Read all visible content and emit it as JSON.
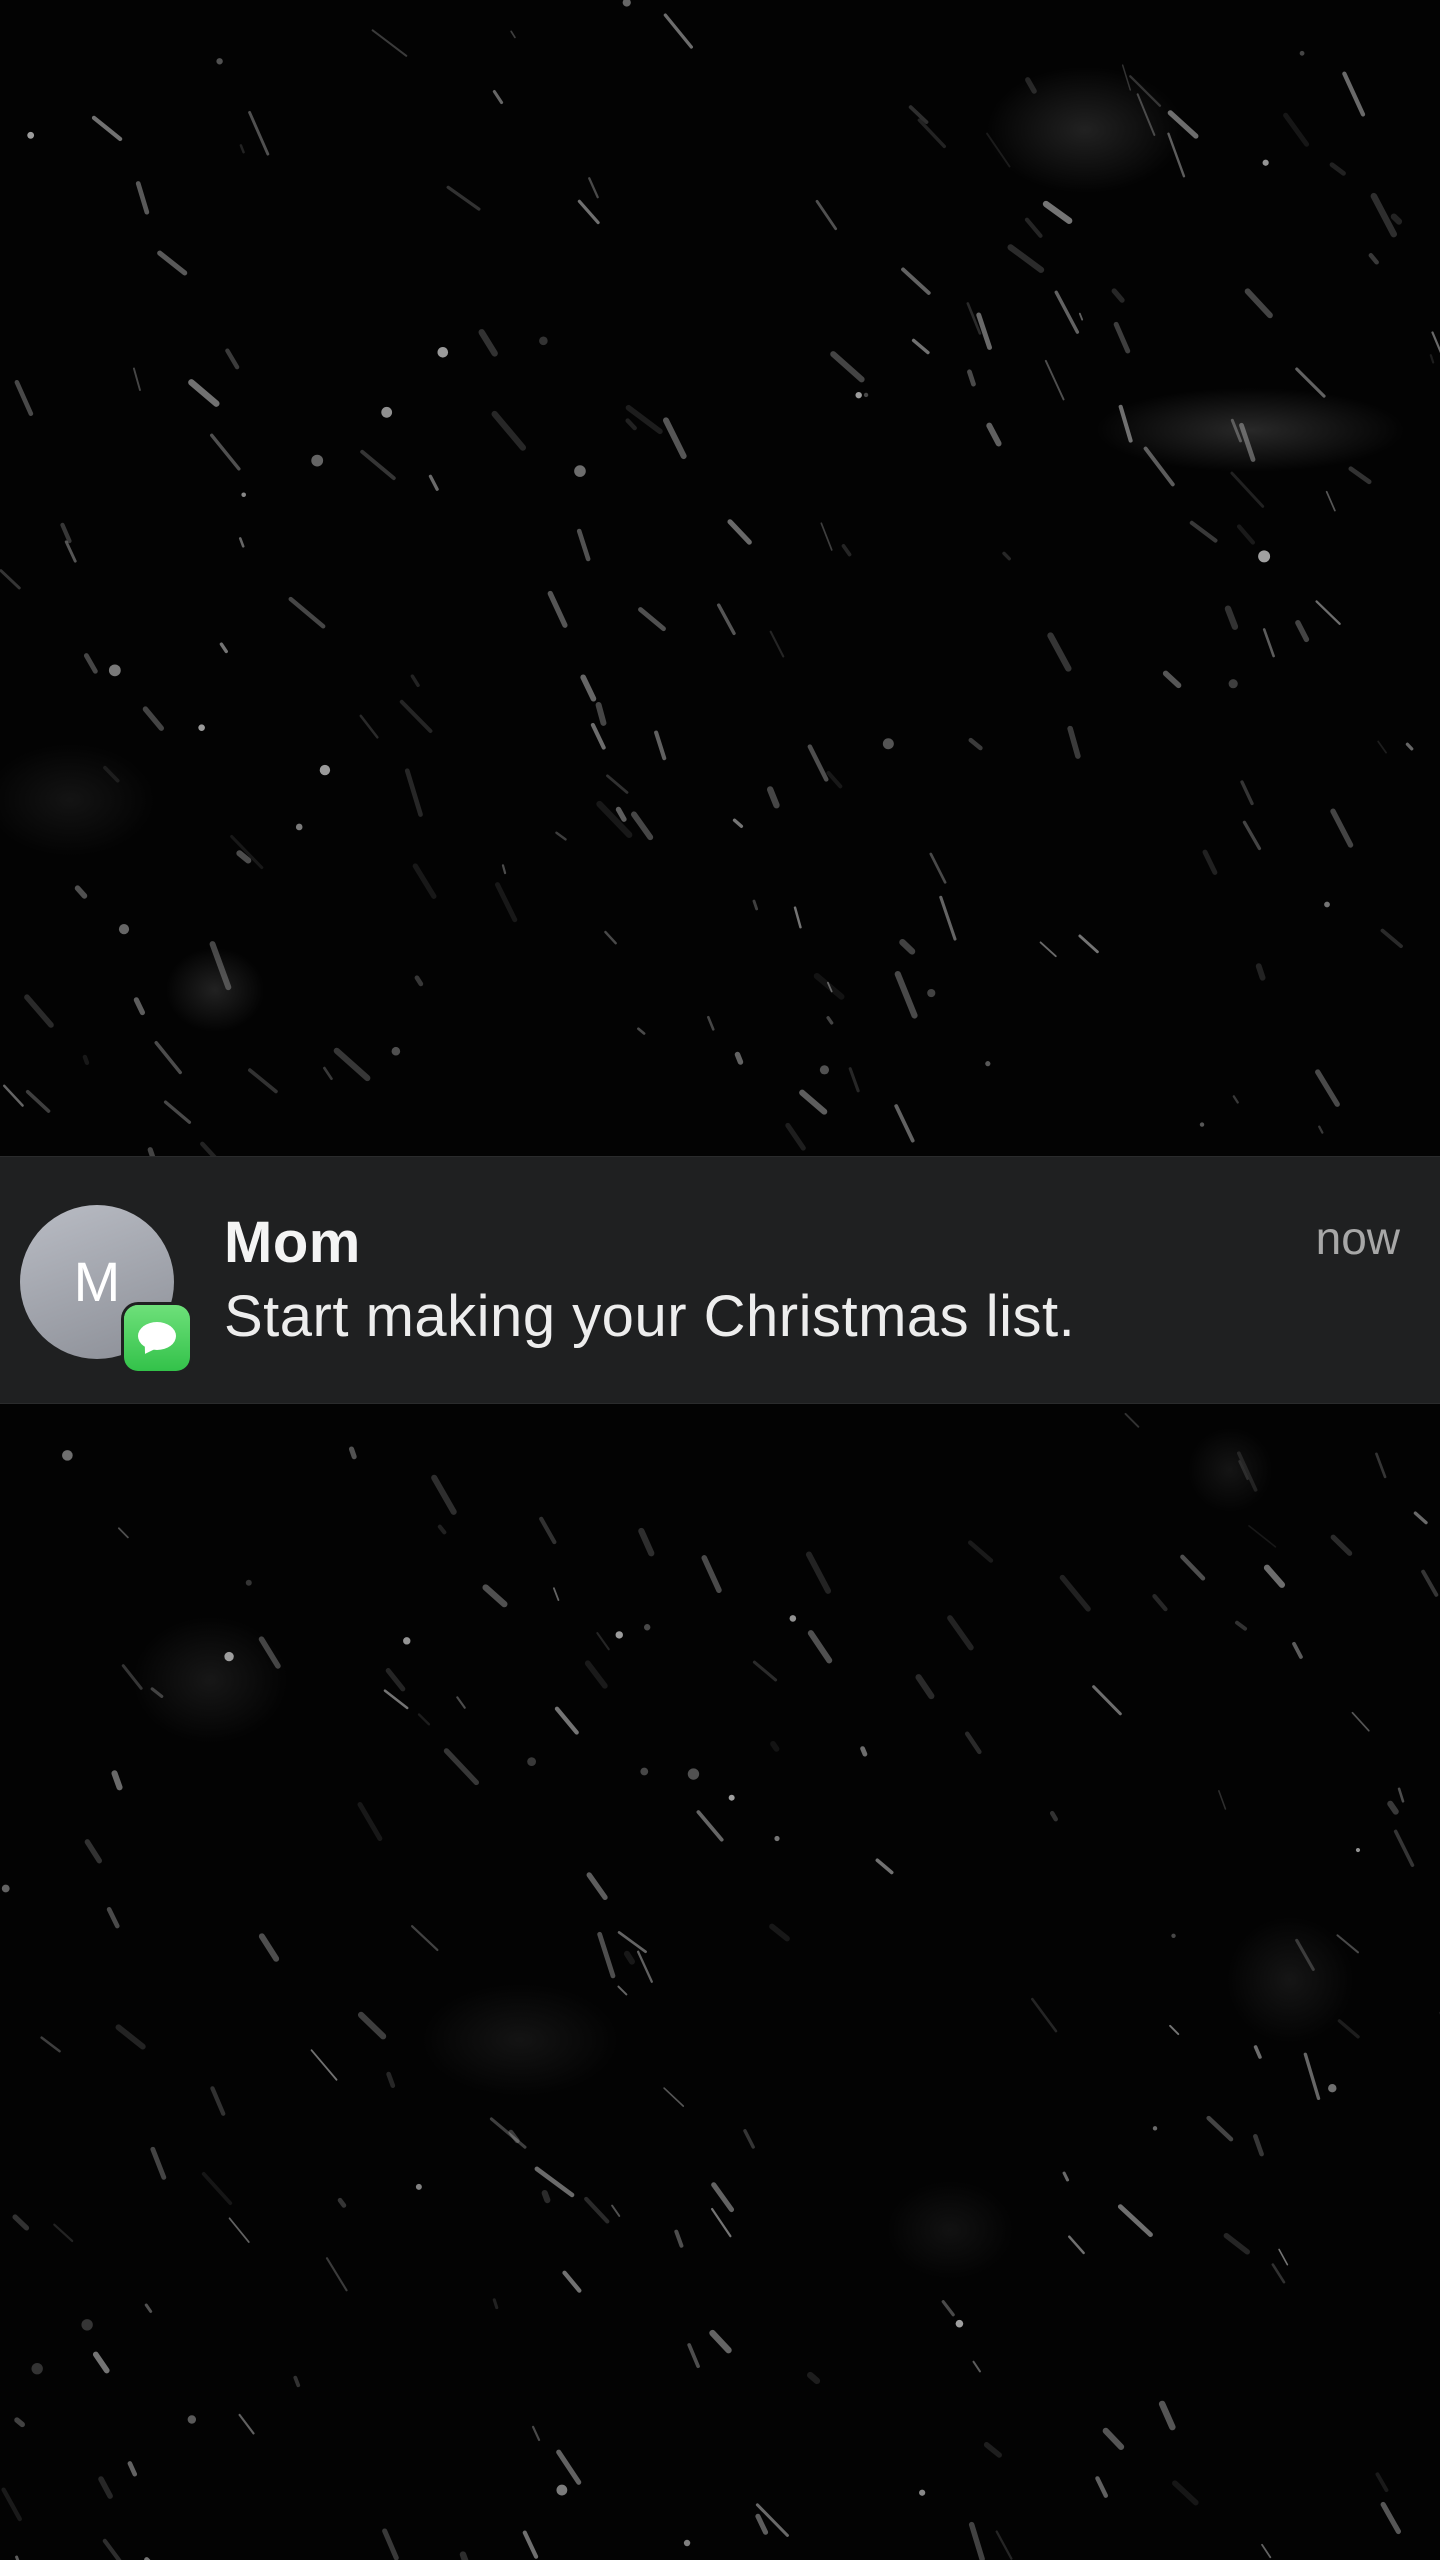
{
  "background": {
    "style": "falling-snow-dark",
    "base_color": "#030303"
  },
  "notification": {
    "avatar_initial": "M",
    "app_icon": "messages-icon",
    "app_icon_color": "#34c759",
    "sender": "Mom",
    "message": "Start making your Christmas list.",
    "time": "now",
    "banner_color": "#1f2021"
  }
}
